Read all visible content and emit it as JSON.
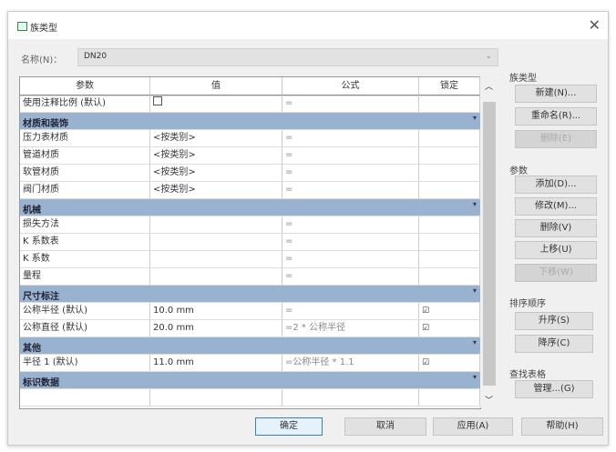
{
  "title": "族类型",
  "name_label": "名称(N)：",
  "name_value": "DN20",
  "columns": [
    "参数",
    "值",
    "公式",
    "锁定"
  ],
  "rows": [
    {
      "type": "param",
      "name": "使用注释比例 (默认)",
      "value": "checkbox",
      "formula": "=",
      "locked": false
    },
    {
      "type": "group",
      "name": "材质和装饰"
    },
    {
      "type": "param",
      "name": "压力表材质",
      "value": "<按类别>",
      "formula": "=",
      "locked": false
    },
    {
      "type": "param",
      "name": "管道材质",
      "value": "<按类别>",
      "formula": "=",
      "locked": false
    },
    {
      "type": "param",
      "name": "软管材质",
      "value": "<按类别>",
      "formula": "=",
      "locked": false
    },
    {
      "type": "param",
      "name": "阀门材质",
      "value": "<按类别>",
      "formula": "=",
      "locked": false
    },
    {
      "type": "group",
      "name": "机械"
    },
    {
      "type": "param",
      "name": "损失方法",
      "value": "",
      "formula": "=",
      "locked": false
    },
    {
      "type": "param",
      "name": "K 系数表",
      "value": "",
      "formula": "=",
      "locked": false
    },
    {
      "type": "param",
      "name": "K 系数",
      "value": "",
      "formula": "=",
      "locked": false
    },
    {
      "type": "param",
      "name": "量程",
      "value": "",
      "formula": "=",
      "locked": false
    },
    {
      "type": "group",
      "name": "尺寸标注"
    },
    {
      "type": "param",
      "name": "公称半径 (默认)",
      "value": "10.0 mm",
      "formula": "=",
      "locked": true
    },
    {
      "type": "param",
      "name": "公称直径 (默认)",
      "value": "20.0 mm",
      "formula": "=2 * 公称半径",
      "locked": true
    },
    {
      "type": "group",
      "name": "其他"
    },
    {
      "type": "param",
      "name": "半径 1 (默认)",
      "value": "11.0 mm",
      "formula": "=公称半径 * 1.1",
      "locked": true
    },
    {
      "type": "group",
      "name": "标识数据"
    },
    {
      "type": "param",
      "name": "",
      "value": "",
      "formula": "",
      "locked": false
    }
  ],
  "side": {
    "family_types_label": "族类型",
    "new": "新建(N)...",
    "rename": "重命名(R)...",
    "delete_type": "删除(E)",
    "params_label": "参数",
    "add": "添加(D)...",
    "modify": "修改(M)...",
    "remove": "删除(V)",
    "up": "上移(U)",
    "down": "下移(W)",
    "sort_label": "排序顺序",
    "asc": "升序(S)",
    "desc": "降序(C)",
    "lookup_label": "查找表格",
    "manage": "管理...(G)"
  },
  "footer": {
    "ok": "确定",
    "cancel": "取消",
    "apply": "应用(A)",
    "help": "帮助(H)"
  }
}
